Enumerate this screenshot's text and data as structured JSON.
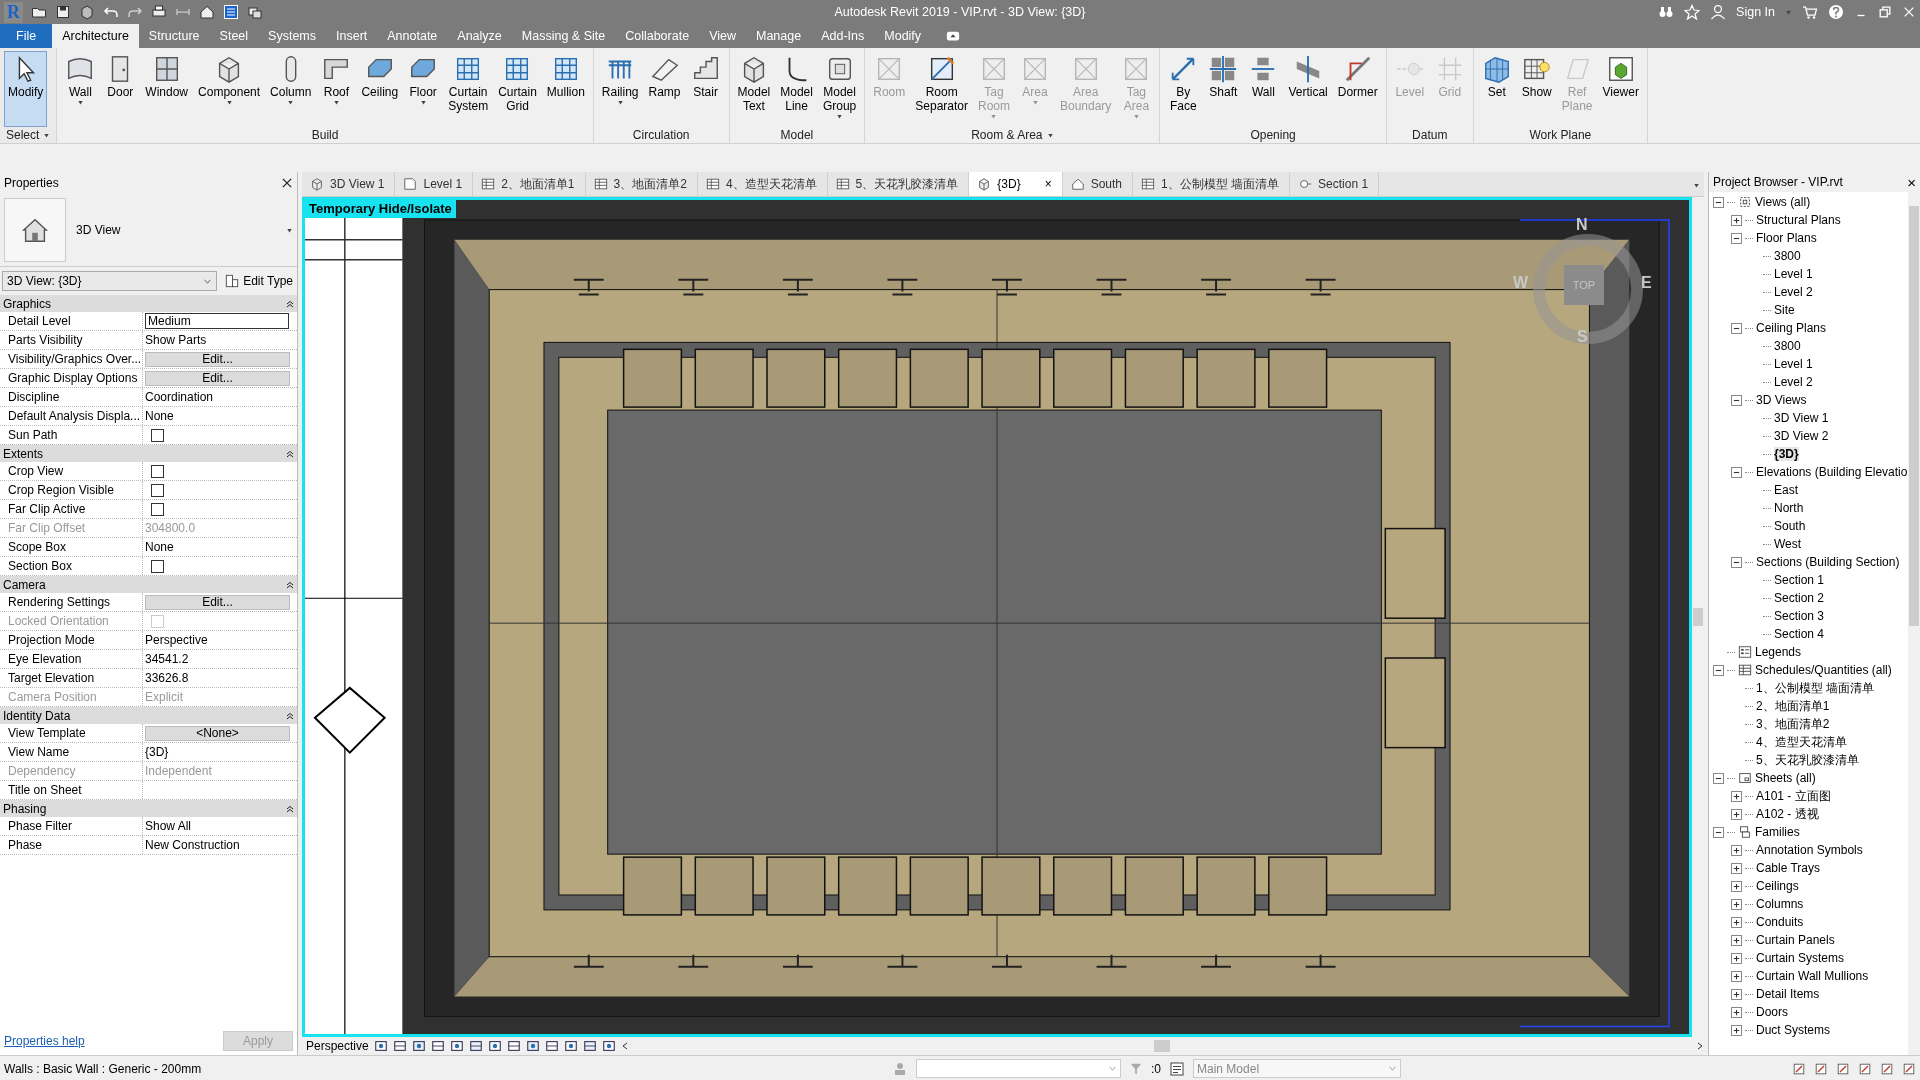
{
  "window": {
    "logo": "R",
    "title": "Autodesk Revit 2019 - VIP.rvt - 3D View: {3D}",
    "sign_in": "Sign In"
  },
  "ribbon_tabs": [
    {
      "label": "File",
      "kind": "file",
      "selected": false
    },
    {
      "label": "Architecture",
      "kind": "tab",
      "selected": true
    },
    {
      "label": "Structure",
      "kind": "tab",
      "selected": false
    },
    {
      "label": "Steel",
      "kind": "tab",
      "selected": false
    },
    {
      "label": "Systems",
      "kind": "tab",
      "selected": false
    },
    {
      "label": "Insert",
      "kind": "tab",
      "selected": false
    },
    {
      "label": "Annotate",
      "kind": "tab",
      "selected": false
    },
    {
      "label": "Analyze",
      "kind": "tab",
      "selected": false
    },
    {
      "label": "Massing & Site",
      "kind": "tab",
      "selected": false
    },
    {
      "label": "Collaborate",
      "kind": "tab",
      "selected": false
    },
    {
      "label": "View",
      "kind": "tab",
      "selected": false
    },
    {
      "label": "Manage",
      "kind": "tab",
      "selected": false
    },
    {
      "label": "Add-Ins",
      "kind": "tab",
      "selected": false
    },
    {
      "label": "Modify",
      "kind": "tab",
      "selected": false
    }
  ],
  "ribbon_panels": [
    {
      "label": "Select",
      "dropdown": true,
      "tools": [
        {
          "label": "Modify",
          "selected": true,
          "disabled": false,
          "dropdown": false
        }
      ]
    },
    {
      "label": "Build",
      "dropdown": false,
      "tools": [
        {
          "label": "Wall",
          "selected": false,
          "disabled": false,
          "dropdown": true
        },
        {
          "label": "Door",
          "selected": false,
          "disabled": false,
          "dropdown": false
        },
        {
          "label": "Window",
          "selected": false,
          "disabled": false,
          "dropdown": false
        },
        {
          "label": "Component",
          "selected": false,
          "disabled": false,
          "dropdown": true
        },
        {
          "label": "Column",
          "selected": false,
          "disabled": false,
          "dropdown": true
        },
        {
          "label": "Roof",
          "selected": false,
          "disabled": false,
          "dropdown": true
        },
        {
          "label": "Ceiling",
          "selected": false,
          "disabled": false,
          "dropdown": false
        },
        {
          "label": "Floor",
          "selected": false,
          "disabled": false,
          "dropdown": true
        },
        {
          "label": "Curtain System",
          "selected": false,
          "disabled": false,
          "dropdown": false
        },
        {
          "label": "Curtain Grid",
          "selected": false,
          "disabled": false,
          "dropdown": false
        },
        {
          "label": "Mullion",
          "selected": false,
          "disabled": false,
          "dropdown": false
        }
      ]
    },
    {
      "label": "Circulation",
      "dropdown": false,
      "tools": [
        {
          "label": "Railing",
          "selected": false,
          "disabled": false,
          "dropdown": true
        },
        {
          "label": "Ramp",
          "selected": false,
          "disabled": false,
          "dropdown": false
        },
        {
          "label": "Stair",
          "selected": false,
          "disabled": false,
          "dropdown": false
        }
      ]
    },
    {
      "label": "Model",
      "dropdown": false,
      "tools": [
        {
          "label": "Model Text",
          "selected": false,
          "disabled": false,
          "dropdown": false
        },
        {
          "label": "Model Line",
          "selected": false,
          "disabled": false,
          "dropdown": false
        },
        {
          "label": "Model Group",
          "selected": false,
          "disabled": false,
          "dropdown": true
        }
      ]
    },
    {
      "label": "Room & Area",
      "dropdown": true,
      "tools": [
        {
          "label": "Room",
          "selected": false,
          "disabled": true,
          "dropdown": false
        },
        {
          "label": "Room Separator",
          "selected": false,
          "disabled": false,
          "dropdown": false
        },
        {
          "label": "Tag Room",
          "selected": false,
          "disabled": true,
          "dropdown": true
        },
        {
          "label": "Area",
          "selected": false,
          "disabled": true,
          "dropdown": true
        },
        {
          "label": "Area Boundary",
          "selected": false,
          "disabled": true,
          "dropdown": false
        },
        {
          "label": "Tag Area",
          "selected": false,
          "disabled": true,
          "dropdown": true
        }
      ]
    },
    {
      "label": "Opening",
      "dropdown": false,
      "tools": [
        {
          "label": "By Face",
          "selected": false,
          "disabled": false,
          "dropdown": false
        },
        {
          "label": "Shaft",
          "selected": false,
          "disabled": false,
          "dropdown": false
        },
        {
          "label": "Wall",
          "selected": false,
          "disabled": false,
          "dropdown": false
        },
        {
          "label": "Vertical",
          "selected": false,
          "disabled": false,
          "dropdown": false
        },
        {
          "label": "Dormer",
          "selected": false,
          "disabled": false,
          "dropdown": false
        }
      ]
    },
    {
      "label": "Datum",
      "dropdown": false,
      "tools": [
        {
          "label": "Level",
          "selected": false,
          "disabled": true,
          "dropdown": false
        },
        {
          "label": "Grid",
          "selected": false,
          "disabled": true,
          "dropdown": false
        }
      ]
    },
    {
      "label": "Work Plane",
      "dropdown": false,
      "tools": [
        {
          "label": "Set",
          "selected": false,
          "disabled": false,
          "dropdown": false
        },
        {
          "label": "Show",
          "selected": false,
          "disabled": false,
          "dropdown": false
        },
        {
          "label": "Ref Plane",
          "selected": false,
          "disabled": true,
          "dropdown": false
        },
        {
          "label": "Viewer",
          "selected": false,
          "disabled": false,
          "dropdown": false
        }
      ]
    }
  ],
  "properties": {
    "title": "Properties",
    "type_name": "3D View",
    "instance_selector": "3D View: {3D}",
    "edit_type": "Edit Type",
    "sections": [
      {
        "name": "Graphics",
        "rows": [
          {
            "label": "Detail Level",
            "value": "Medium",
            "kind": "field",
            "disabled": false
          },
          {
            "label": "Parts Visibility",
            "value": "Show Parts",
            "kind": "text",
            "disabled": false
          },
          {
            "label": "Visibility/Graphics Over...",
            "value": "Edit...",
            "kind": "button",
            "disabled": false
          },
          {
            "label": "Graphic Display Options",
            "value": "Edit...",
            "kind": "button",
            "disabled": false
          },
          {
            "label": "Discipline",
            "value": "Coordination",
            "kind": "text",
            "disabled": false
          },
          {
            "label": "Default Analysis Displa...",
            "value": "None",
            "kind": "text",
            "disabled": false
          },
          {
            "label": "Sun Path",
            "kind": "checkbox",
            "checked": false,
            "disabled": false
          }
        ]
      },
      {
        "name": "Extents",
        "rows": [
          {
            "label": "Crop View",
            "kind": "checkbox",
            "checked": false,
            "disabled": false
          },
          {
            "label": "Crop Region Visible",
            "kind": "checkbox",
            "checked": false,
            "disabled": false
          },
          {
            "label": "Far Clip Active",
            "kind": "checkbox",
            "checked": false,
            "disabled": false
          },
          {
            "label": "Far Clip Offset",
            "value": "304800.0",
            "kind": "text",
            "disabled": true
          },
          {
            "label": "Scope Box",
            "value": "None",
            "kind": "text",
            "disabled": false
          },
          {
            "label": "Section Box",
            "kind": "checkbox",
            "checked": false,
            "disabled": false
          }
        ]
      },
      {
        "name": "Camera",
        "rows": [
          {
            "label": "Rendering Settings",
            "value": "Edit...",
            "kind": "button",
            "disabled": false
          },
          {
            "label": "Locked Orientation",
            "kind": "checkbox",
            "checked": false,
            "disabled": true
          },
          {
            "label": "Projection Mode",
            "value": "Perspective",
            "kind": "text",
            "disabled": false
          },
          {
            "label": "Eye Elevation",
            "value": "34541.2",
            "kind": "text",
            "disabled": false
          },
          {
            "label": "Target Elevation",
            "value": "33626.8",
            "kind": "text",
            "disabled": false
          },
          {
            "label": "Camera Position",
            "value": "Explicit",
            "kind": "text",
            "disabled": true
          }
        ]
      },
      {
        "name": "Identity Data",
        "rows": [
          {
            "label": "View Template",
            "value": "<None>",
            "kind": "button",
            "disabled": false
          },
          {
            "label": "View Name",
            "value": "{3D}",
            "kind": "text",
            "disabled": false
          },
          {
            "label": "Dependency",
            "value": "Independent",
            "kind": "text",
            "disabled": true
          },
          {
            "label": "Title on Sheet",
            "kind": "text",
            "disabled": false
          }
        ]
      },
      {
        "name": "Phasing",
        "rows": [
          {
            "label": "Phase Filter",
            "value": "Show All",
            "kind": "text",
            "disabled": false
          },
          {
            "label": "Phase",
            "value": "New Construction",
            "kind": "text",
            "disabled": false
          }
        ]
      }
    ],
    "help_link": "Properties help",
    "apply": {
      "label": "Apply",
      "disabled": true
    }
  },
  "view_tabs": [
    {
      "label": "3D View 1",
      "kind": "isometric",
      "selected": false
    },
    {
      "label": "Level 1",
      "kind": "plan",
      "selected": false
    },
    {
      "label": "2、地面清单1",
      "kind": "schedule",
      "selected": false
    },
    {
      "label": "3、地面清单2",
      "kind": "schedule",
      "selected": false
    },
    {
      "label": "4、造型天花清单",
      "kind": "schedule",
      "selected": false
    },
    {
      "label": "5、天花乳胶漆清单",
      "kind": "schedule",
      "selected": false
    },
    {
      "label": "{3D}",
      "kind": "isometric",
      "selected": true,
      "close": "×"
    },
    {
      "label": "South",
      "kind": "elevation",
      "selected": false
    },
    {
      "label": "1、公制模型 墙面清单",
      "kind": "schedule",
      "selected": false
    },
    {
      "label": "Section 1",
      "kind": "section",
      "selected": false
    }
  ],
  "view": {
    "mode_banner": "Temporary Hide/Isolate",
    "view_cube": {
      "north": "N",
      "south": "S",
      "east": "E",
      "west": "W",
      "face": "TOP"
    },
    "control_bar": {
      "projection": "Perspective"
    }
  },
  "project_browser": {
    "title": "Project Browser - VIP.rvt",
    "close": "×",
    "tree": [
      {
        "label": "Views (all)",
        "expanded": true,
        "selected": false,
        "children": [
          {
            "label": "Structural Plans",
            "expanded": false,
            "selected": false
          },
          {
            "label": "Floor Plans",
            "expanded": true,
            "selected": false,
            "children": [
              {
                "label": "3800",
                "selected": false
              },
              {
                "label": "Level 1",
                "selected": false
              },
              {
                "label": "Level 2",
                "selected": false
              },
              {
                "label": "Site",
                "selected": false
              }
            ]
          },
          {
            "label": "Ceiling Plans",
            "expanded": true,
            "selected": false,
            "children": [
              {
                "label": "3800",
                "selected": false
              },
              {
                "label": "Level 1",
                "selected": false
              },
              {
                "label": "Level 2",
                "selected": false
              }
            ]
          },
          {
            "label": "3D Views",
            "expanded": true,
            "selected": false,
            "children": [
              {
                "label": "3D View 1",
                "selected": false
              },
              {
                "label": "3D View 2",
                "selected": false
              },
              {
                "label": "{3D}",
                "selected": true
              }
            ]
          },
          {
            "label": "Elevations (Building Elevatio",
            "expanded": true,
            "selected": false,
            "children": [
              {
                "label": "East",
                "selected": false
              },
              {
                "label": "North",
                "selected": false
              },
              {
                "label": "South",
                "selected": false
              },
              {
                "label": "West",
                "selected": false
              }
            ]
          },
          {
            "label": "Sections (Building Section)",
            "expanded": true,
            "selected": false,
            "children": [
              {
                "label": "Section 1",
                "selected": false
              },
              {
                "label": "Section 2",
                "selected": false
              },
              {
                "label": "Section 3",
                "selected": false
              },
              {
                "label": "Section 4",
                "selected": false
              }
            ]
          }
        ]
      },
      {
        "label": "Legends",
        "selected": false
      },
      {
        "label": "Schedules/Quantities (all)",
        "expanded": true,
        "selected": false,
        "children": [
          {
            "label": "1、公制模型 墙面清单",
            "selected": false
          },
          {
            "label": "2、地面清单1",
            "selected": false
          },
          {
            "label": "3、地面清单2",
            "selected": false
          },
          {
            "label": "4、造型天花清单",
            "selected": false
          },
          {
            "label": "5、天花乳胶漆清单",
            "selected": false
          }
        ]
      },
      {
        "label": "Sheets (all)",
        "expanded": true,
        "selected": false,
        "children": [
          {
            "label": "A101 - 立面图",
            "expanded": false,
            "selected": false
          },
          {
            "label": "A102 - 透视",
            "expanded": false,
            "selected": false
          }
        ]
      },
      {
        "label": "Families",
        "expanded": true,
        "selected": false,
        "children": [
          {
            "label": "Annotation Symbols",
            "expanded": false,
            "selected": false
          },
          {
            "label": "Cable Trays",
            "expanded": false,
            "selected": false
          },
          {
            "label": "Ceilings",
            "expanded": false,
            "selected": false
          },
          {
            "label": "Columns",
            "expanded": false,
            "selected": false
          },
          {
            "label": "Conduits",
            "expanded": false,
            "selected": false
          },
          {
            "label": "Curtain Panels",
            "expanded": false,
            "selected": false
          },
          {
            "label": "Curtain Systems",
            "expanded": false,
            "selected": false
          },
          {
            "label": "Curtain Wall Mullions",
            "expanded": false,
            "selected": false
          },
          {
            "label": "Detail Items",
            "expanded": false,
            "selected": false
          },
          {
            "label": "Doors",
            "expanded": false,
            "selected": false
          },
          {
            "label": "Duct Systems",
            "expanded": false,
            "selected": false
          }
        ]
      }
    ]
  },
  "status_bar": {
    "message": "Walls : Basic Wall : Generic - 200mm",
    "count": ":0",
    "model": "Main Model"
  }
}
